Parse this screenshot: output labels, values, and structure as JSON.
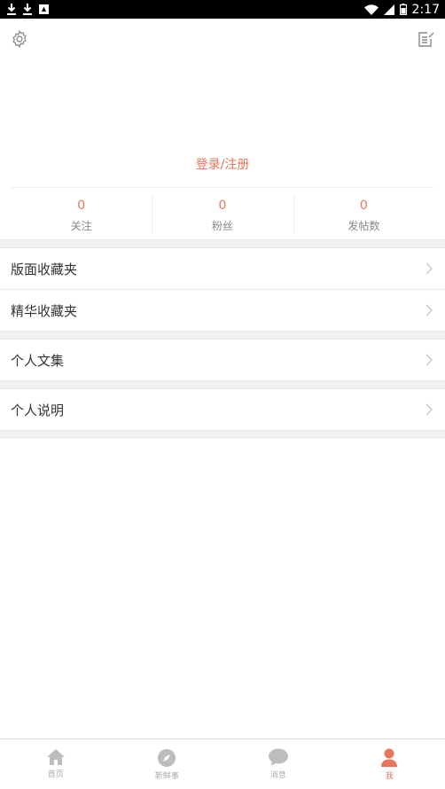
{
  "status_bar": {
    "time": "2:17"
  },
  "top_bar": {
    "settings_icon": "gear-icon",
    "edit_icon": "edit-icon"
  },
  "login_register": "登录/注册",
  "stats": [
    {
      "value": "0",
      "label": "关注"
    },
    {
      "value": "0",
      "label": "粉丝"
    },
    {
      "value": "0",
      "label": "发帖数"
    }
  ],
  "menu": {
    "board_favorites": "版面收藏夹",
    "digest_favorites": "精华收藏夹",
    "personal_collection": "个人文集",
    "personal_description": "个人说明"
  },
  "tabs": [
    {
      "label": "首页",
      "icon": "home-icon"
    },
    {
      "label": "新鲜事",
      "icon": "compass-icon"
    },
    {
      "label": "消息",
      "icon": "message-icon"
    },
    {
      "label": "我",
      "icon": "user-icon",
      "active": true
    }
  ],
  "colors": {
    "accent": "#e8765a",
    "inactive": "#bdbdbd",
    "separator": "#f1f1f1"
  }
}
